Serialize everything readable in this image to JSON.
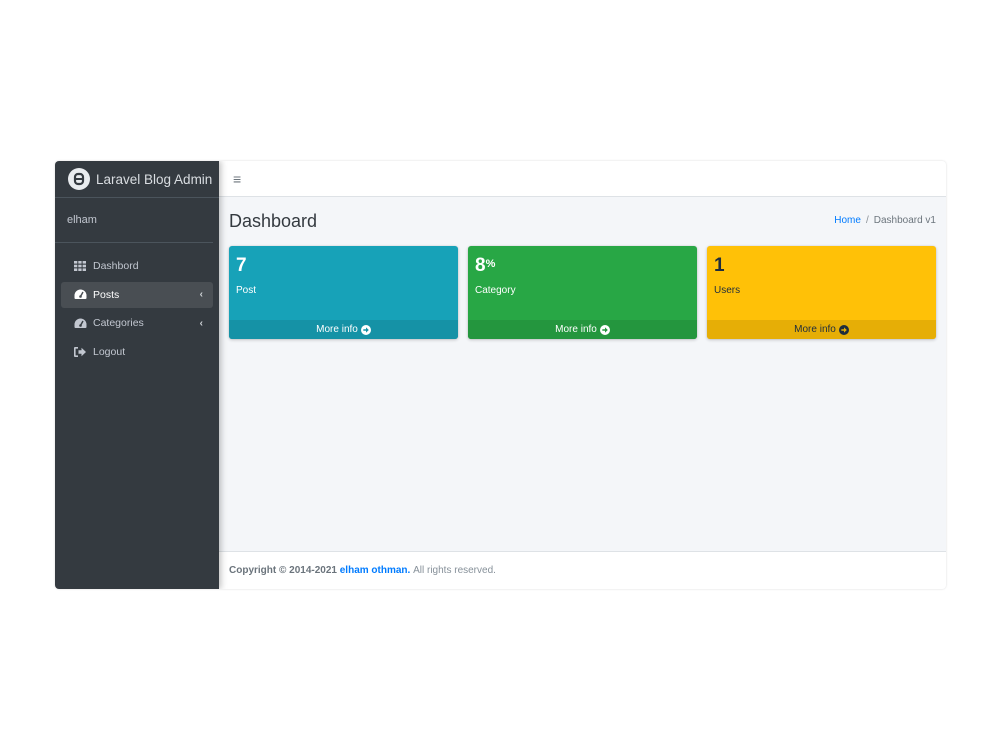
{
  "brand": {
    "title": "Laravel Blog Admin"
  },
  "user": {
    "name": "elham"
  },
  "sidebar": {
    "items": [
      {
        "label": "Dashbord",
        "icon": "th-icon",
        "active": false,
        "chevron": false
      },
      {
        "label": "Posts",
        "icon": "tachometer-icon",
        "active": true,
        "chevron": true
      },
      {
        "label": "Categories",
        "icon": "tachometer-icon",
        "active": false,
        "chevron": true
      },
      {
        "label": "Logout",
        "icon": "sign-out-icon",
        "active": false,
        "chevron": false
      }
    ],
    "chevron_glyph": "‹"
  },
  "topbar": {
    "menu_icon": "≡"
  },
  "header": {
    "title": "Dashboard",
    "breadcrumb": {
      "home": "Home",
      "separator": "/",
      "current": "Dashboard v1"
    }
  },
  "boxes": [
    {
      "value": "7",
      "suffix": "",
      "label": "Post",
      "footer": "More info",
      "color": "#17a2b8"
    },
    {
      "value": "8",
      "suffix": "%",
      "label": "Category",
      "footer": "More info",
      "color": "#28a745"
    },
    {
      "value": "1",
      "suffix": "",
      "label": "Users",
      "footer": "More info",
      "color": "#ffc107"
    }
  ],
  "footer": {
    "copyright": "Copyright © 2014-2021",
    "author": "elham othman.",
    "rights": "All rights reserved."
  }
}
